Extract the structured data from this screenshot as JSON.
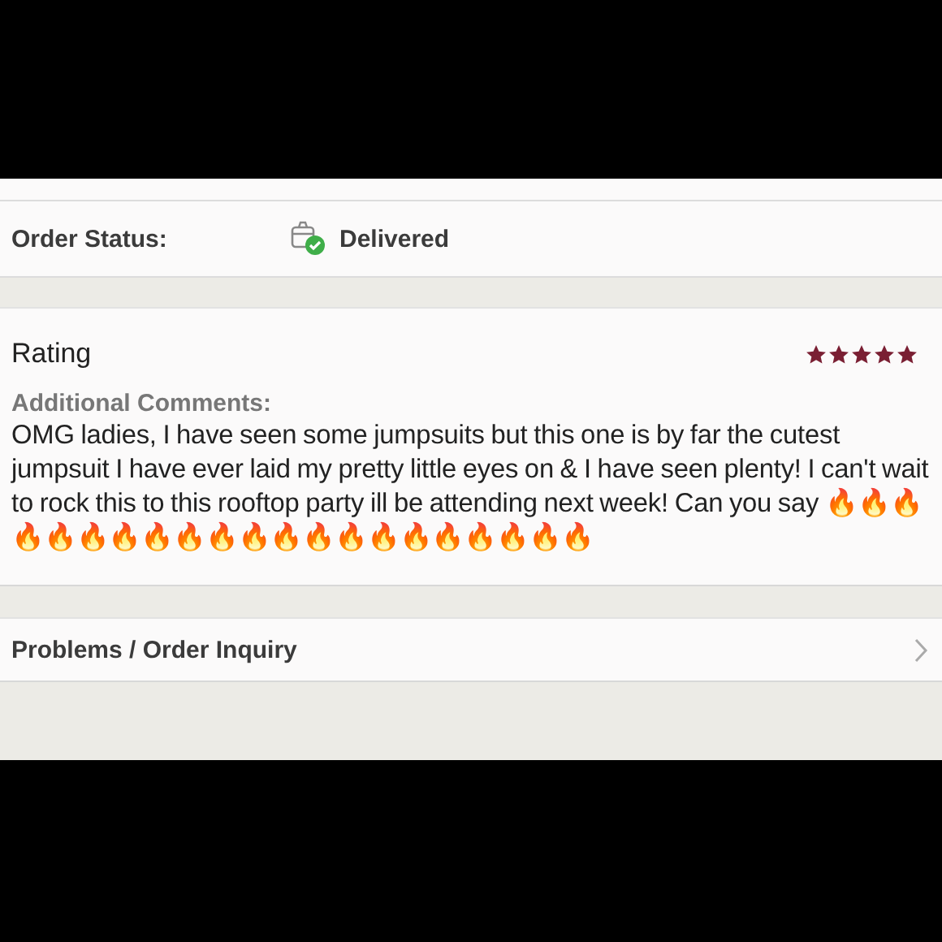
{
  "order_status": {
    "label": "Order Status:",
    "value": "Delivered"
  },
  "rating": {
    "title": "Rating",
    "stars": 5,
    "comments_label": "Additional Comments:",
    "comment": "OMG ladies, I have seen some jumpsuits but this one is by far the cutest jumpsuit I have ever laid my pretty little eyes on & I have seen plenty! I can't wait to rock this to this rooftop party ill be attending next week! Can you say 🔥🔥🔥🔥🔥🔥🔥🔥🔥🔥🔥🔥🔥🔥🔥🔥🔥🔥🔥🔥🔥"
  },
  "problems_link": {
    "label": "Problems / Order Inquiry"
  }
}
